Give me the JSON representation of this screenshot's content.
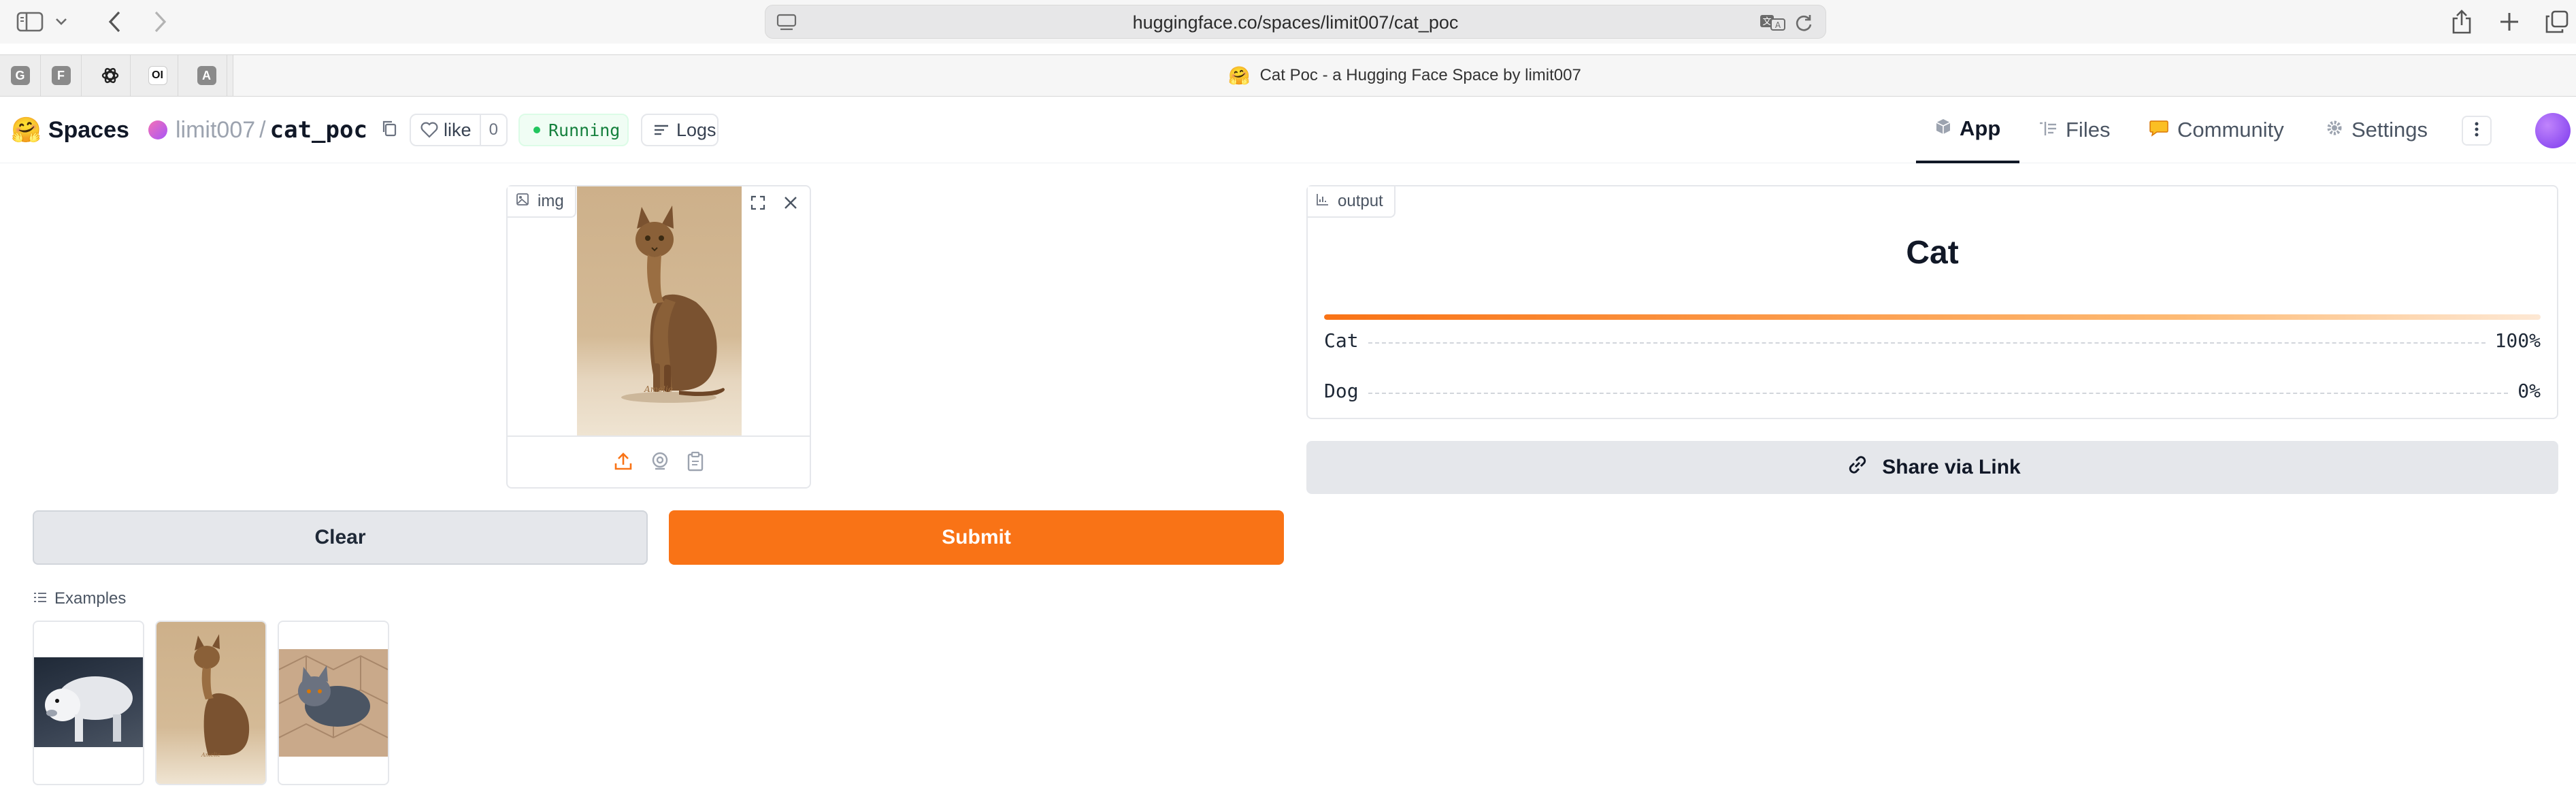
{
  "browser": {
    "url": "huggingface.co/spaces/limit007/cat_poc",
    "tab_title": "Cat Poc - a Hugging Face Space by limit007",
    "pinned_tabs": [
      "G",
      "F",
      "openai",
      "OI",
      "A"
    ]
  },
  "header": {
    "brand": "Spaces",
    "owner": "limit007",
    "separator": "/",
    "repo": "cat_poc",
    "like_label": "like",
    "like_count": "0",
    "status": "Running",
    "logs_label": "Logs",
    "tabs": [
      {
        "label": "App",
        "icon": "app-cube-icon",
        "active": true
      },
      {
        "label": "Files",
        "icon": "files-icon",
        "active": false
      },
      {
        "label": "Community",
        "icon": "community-icon",
        "active": false
      },
      {
        "label": "Settings",
        "icon": "gear-icon",
        "active": false
      }
    ]
  },
  "input": {
    "label": "img",
    "clear_label": "Clear",
    "submit_label": "Submit"
  },
  "output": {
    "label": "output",
    "top_label": "Cat",
    "confidences": [
      {
        "label": "Cat",
        "value": "100%",
        "fraction": 1.0
      },
      {
        "label": "Dog",
        "value": "0%",
        "fraction": 0.0
      }
    ],
    "share_label": "Share via Link"
  },
  "examples": {
    "label": "Examples",
    "items": [
      "white-dog-image",
      "cat-sitting-image",
      "gray-kitten-image"
    ]
  },
  "colors": {
    "accent": "#f97316",
    "status_green": "#16a34a",
    "avatar": "#a855f7"
  }
}
